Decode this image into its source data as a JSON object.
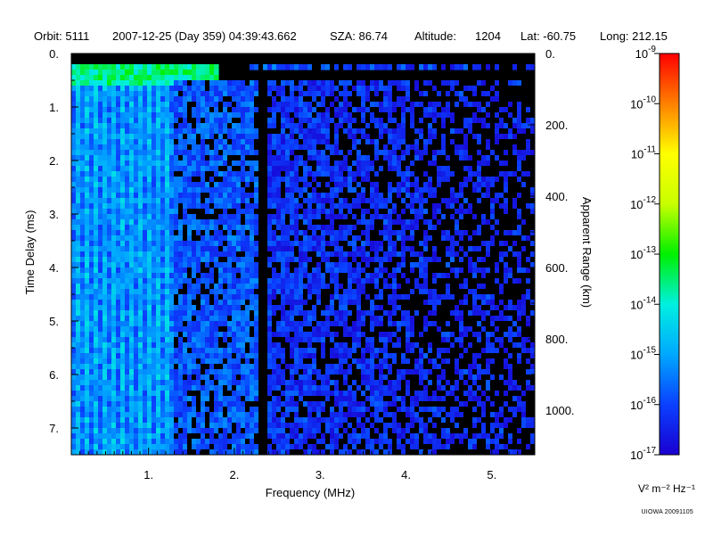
{
  "header": {
    "orbit": "Orbit: 5111",
    "datetime": "2007-12-25 (Day 359) 04:39:43.662",
    "sza": "SZA:  86.74",
    "altitude_label": "Altitude:",
    "altitude_value": "1204",
    "lat": "Lat: -60.75",
    "long": "Long: 212.15"
  },
  "credit": "UIOWA 20091105",
  "colors": {
    "background": "#000000",
    "scale": [
      "#1a00d0",
      "#0a40ff",
      "#00a8ff",
      "#00f0e0",
      "#00f000",
      "#c8ff00",
      "#ffff00",
      "#ff8000",
      "#ff0000"
    ]
  },
  "chart_data": {
    "type": "heatmap",
    "title": "",
    "xlabel": "Frequency (MHz)",
    "ylabel": "Time Delay (ms)",
    "y2label": "Apparent Range (km)",
    "xlim": [
      0.1,
      5.5
    ],
    "ylim": [
      7.5,
      0
    ],
    "y2lim": [
      0,
      1125
    ],
    "x_ticks": [
      1,
      2,
      3,
      4,
      5
    ],
    "x_tick_labels": [
      "1.",
      "2.",
      "3.",
      "4.",
      "5."
    ],
    "y_ticks": [
      0,
      1,
      2,
      3,
      4,
      5,
      6,
      7
    ],
    "y_tick_labels": [
      "0.",
      "1.",
      "2.",
      "3.",
      "4.",
      "5.",
      "6.",
      "7."
    ],
    "y2_ticks": [
      0,
      200,
      400,
      600,
      800,
      1000
    ],
    "y2_tick_labels": [
      "0.",
      "200.",
      "400.",
      "600.",
      "800.",
      "1000."
    ],
    "colorbar": {
      "scale": "log",
      "range": [
        1e-17,
        1e-09
      ],
      "tick_exponents": [
        -9,
        -10,
        -11,
        -12,
        -13,
        -14,
        -15,
        -16,
        -17
      ],
      "tick_base": "10",
      "unit_label": "V² m⁻² Hz⁻¹"
    },
    "features": [
      {
        "name": "dense striations",
        "x_range": [
          0.1,
          1.3
        ],
        "delay_range": [
          0.25,
          7.5
        ],
        "log_level": -14.8
      },
      {
        "name": "strong low-delay band",
        "x_range": [
          0.1,
          1.8
        ],
        "delay_range": [
          0.25,
          0.6
        ],
        "log_level": -13.6
      },
      {
        "name": "diffuse echo region",
        "x_range": [
          1.3,
          2.3
        ],
        "delay_range": [
          0.5,
          7.5
        ],
        "log_level": -15.8
      },
      {
        "name": "dark gap",
        "x_range": [
          2.28,
          2.38
        ],
        "delay_range": [
          0.45,
          7.5
        ],
        "log_level": -17
      },
      {
        "name": "faint returns",
        "x_range": [
          2.38,
          5.5
        ],
        "delay_range": [
          0.5,
          7.5
        ],
        "log_level": -16.2
      },
      {
        "name": "top echo line",
        "x_range": [
          2.2,
          5.5
        ],
        "delay_range": [
          0.25,
          0.35
        ],
        "log_level": -15.8
      }
    ]
  }
}
